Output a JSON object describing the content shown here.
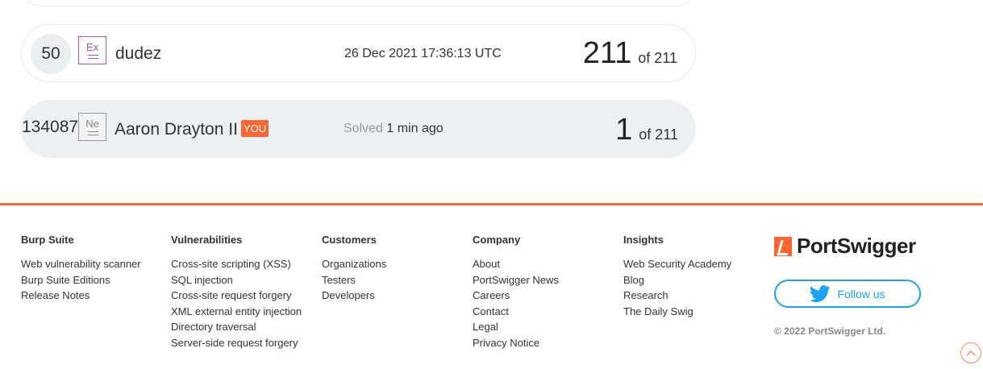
{
  "leaderboard": {
    "rows": [
      {
        "rank": "50",
        "badge": "Ex",
        "name": "dudez",
        "info": "26 Dec 2021 17:36:13 UTC",
        "score": "211",
        "total": "of 211"
      },
      {
        "rank": "134087",
        "badge": "Ne",
        "name": "Aaron Drayton II",
        "you_label": "YOU",
        "info_muted": "Solved",
        "info": "1 min ago",
        "score": "1",
        "total": "of 211"
      }
    ]
  },
  "footer": {
    "columns": [
      {
        "title": "Burp Suite",
        "links": [
          "Web vulnerability scanner",
          "Burp Suite Editions",
          "Release Notes"
        ]
      },
      {
        "title": "Vulnerabilities",
        "links": [
          "Cross-site scripting (XSS)",
          "SQL injection",
          "Cross-site request forgery",
          "XML external entity injection",
          "Directory traversal",
          "Server-side request forgery"
        ]
      },
      {
        "title": "Customers",
        "links": [
          "Organizations",
          "Testers",
          "Developers"
        ]
      },
      {
        "title": "Company",
        "links": [
          "About",
          "PortSwigger News",
          "Careers",
          "Contact",
          "Legal",
          "Privacy Notice"
        ]
      },
      {
        "title": "Insights",
        "links": [
          "Web Security Academy",
          "Blog",
          "Research",
          "The Daily Swig"
        ]
      }
    ],
    "brand": "PortSwigger",
    "follow_label": "Follow us",
    "copyright": "© 2022 PortSwigger Ltd."
  },
  "colors": {
    "accent": "#ff6633",
    "twitter": "#1da1f2",
    "highlight_row": "#ebf0f2"
  }
}
